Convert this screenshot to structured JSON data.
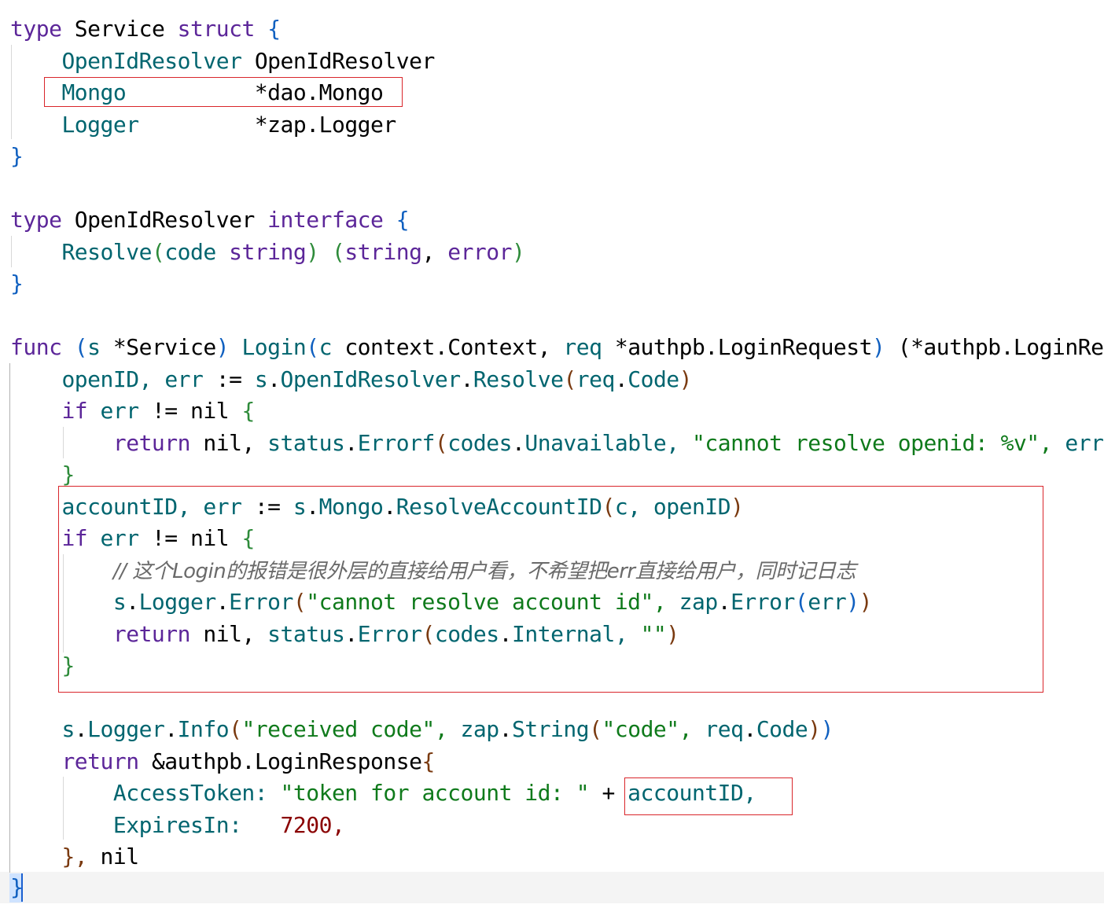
{
  "code": {
    "struct_decl": {
      "kw_type": "type",
      "name": "Service",
      "kw_struct": "struct",
      "open": "{",
      "close": "}",
      "fields": [
        {
          "name": "OpenIdResolver",
          "type": "OpenIdResolver"
        },
        {
          "name": "Mongo",
          "type": "*dao.Mongo"
        },
        {
          "name": "Logger",
          "type": "*zap.Logger"
        }
      ]
    },
    "iface_decl": {
      "kw_type": "type",
      "name": "OpenIdResolver",
      "kw_interface": "interface",
      "open": "{",
      "close": "}",
      "method": {
        "name": "Resolve",
        "param": "code",
        "param_type": "string",
        "ret1": "string",
        "ret2": "error"
      }
    },
    "func_decl": {
      "kw_func": "func",
      "recv": "s",
      "recv_type": "*Service",
      "name": "Login",
      "p1": "c",
      "p1_type": "context.Context,",
      "p2": "req",
      "p2_type": "*authpb.LoginRequest",
      "ret_start": "(*authpb.LoginRe"
    },
    "body": {
      "l1": {
        "a": "openID,",
        "b": "err",
        "op": ":=",
        "recv": "s",
        "f": "OpenIdResolver",
        "m": "Resolve",
        "arg_pkg": "req",
        "arg": "Code"
      },
      "l2": {
        "kw": "if",
        "v": "err",
        "op": "!=",
        "nil": "nil",
        "brace": "{"
      },
      "l3": {
        "kw": "return",
        "nil": "nil,",
        "pkg": "status",
        "f": "Errorf",
        "pkg2": "codes",
        "c": "Unavailable,",
        "str": "\"cannot resolve openid: %v\",",
        "tail": "err"
      },
      "l4": {
        "brace": "}"
      },
      "l5": {
        "a": "accountID,",
        "b": "err",
        "op": ":=",
        "recv": "s",
        "f": "Mongo",
        "m": "ResolveAccountID",
        "a1": "c,",
        "a2": "openID"
      },
      "l6": {
        "kw": "if",
        "v": "err",
        "op": "!=",
        "nil": "nil",
        "brace": "{"
      },
      "l7": {
        "comment": "// 这个Login的报错是很外层的直接给用户看，不希望把err直接给用户，同时记日志"
      },
      "l8": {
        "recv": "s",
        "f": "Logger",
        "m": "Error",
        "str": "\"cannot resolve account id\",",
        "pkg": "zap",
        "m2": "Error",
        "arg": "err"
      },
      "l9": {
        "kw": "return",
        "nil": "nil,",
        "pkg": "status",
        "f": "Error",
        "pkg2": "codes",
        "c": "Internal,",
        "str": "\"\""
      },
      "l10": {
        "brace": "}"
      },
      "l11": {
        "recv": "s",
        "f": "Logger",
        "m": "Info",
        "str": "\"received code\",",
        "pkg": "zap",
        "m2": "String",
        "str2": "\"code\",",
        "arg_pkg": "req",
        "arg": "Code"
      },
      "l12": {
        "kw": "return",
        "expr": "&authpb.LoginResponse",
        "brace": "{"
      },
      "l13": {
        "field": "AccessToken:",
        "str": "\"token for account id: \"",
        "op": "+",
        "v": "accountID,"
      },
      "l14": {
        "field": "ExpiresIn:",
        "num": "7200,"
      },
      "l15": {
        "close": "},",
        "nil": "nil"
      },
      "l16": {
        "close": "}"
      }
    }
  },
  "colors": {
    "keyword": "#5c2699",
    "identifier": "#00656f",
    "string": "#0f7a1b",
    "number": "#8a0000",
    "comment": "#6a6a6a",
    "highlight_box": "#d9262b"
  }
}
